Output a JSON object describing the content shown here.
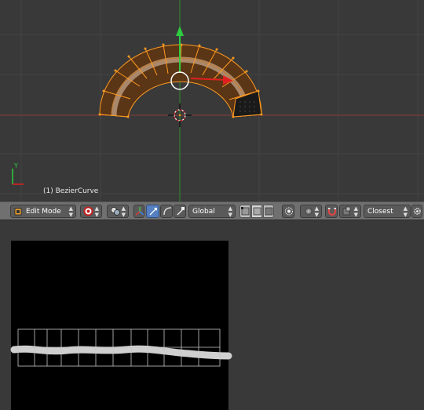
{
  "viewport": {
    "object_label": "(1) BezierCurve",
    "axis_y_label": "Y",
    "colors": {
      "background": "#393939",
      "grid": "#3f3f3f",
      "x_axis": "#8a3a3a",
      "y_axis": "#2e8b2e",
      "mesh_face": "#5a3516",
      "mesh_stripe": "#b8967a",
      "selection": "#ff9a1f"
    }
  },
  "header": {
    "mode": "Edit Mode",
    "transform_orientation": "Global",
    "snap_target": "Closest",
    "icons": [
      "editor-type-icon",
      "mode-icon",
      "shading-icon",
      "pivot-icon",
      "manipulator-axis-icon",
      "translate-icon",
      "rotate-icon",
      "scale-icon",
      "vertex-select-icon",
      "edge-select-icon",
      "face-select-icon",
      "occlude-geometry-icon",
      "proportional-edit-icon",
      "snap-magnet-icon",
      "snap-element-icon",
      "snap-settings-icon"
    ]
  },
  "uv_editor": {
    "colors": {
      "image_background": "#000000",
      "uv_grid": "#d0d0d0",
      "stripe": "#cfcfcf"
    }
  }
}
